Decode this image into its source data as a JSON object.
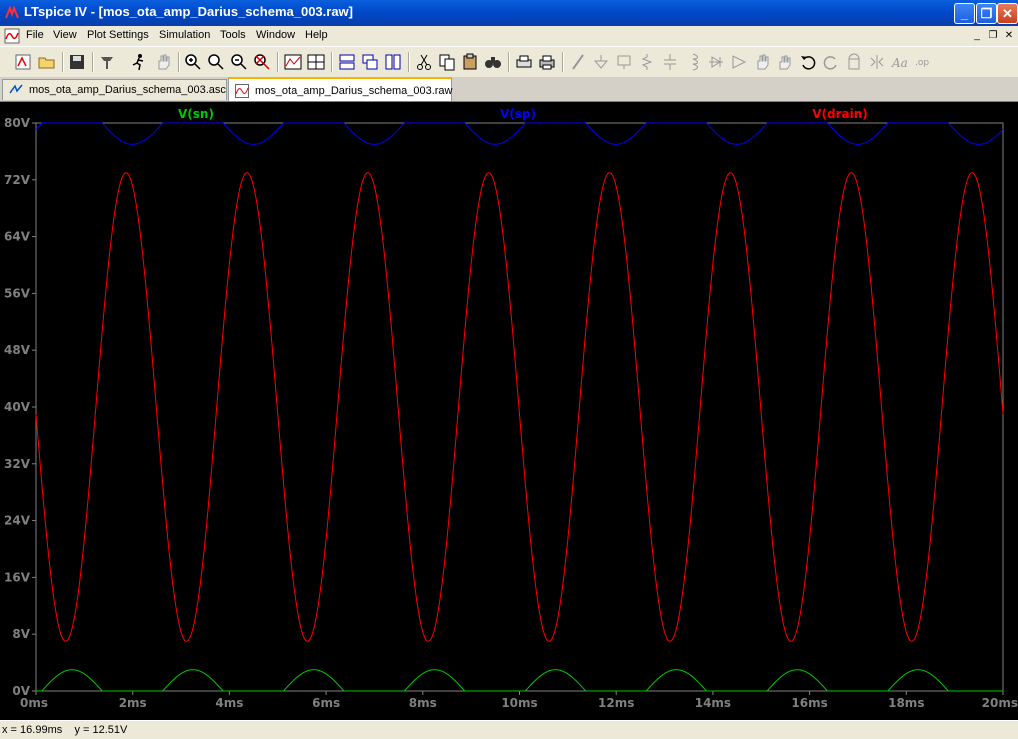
{
  "window": {
    "title": "LTspice IV - [mos_ota_amp_Darius_schema_003.raw]",
    "minimize": "_",
    "maximize": "❐",
    "close": "✕"
  },
  "menu": {
    "items": [
      "File",
      "View",
      "Plot Settings",
      "Simulation",
      "Tools",
      "Window",
      "Help"
    ],
    "mdi_restore": "_",
    "mdi_max": "❐",
    "mdi_close": "✕"
  },
  "tabs": [
    {
      "label": "mos_ota_amp_Darius_schema_003.asc",
      "icon": "schematic-icon"
    },
    {
      "label": "mos_ota_amp_Darius_schema_003.raw",
      "icon": "waveform-icon",
      "active": true
    }
  ],
  "status": {
    "text": "x = 16.99ms    y = 12.51V"
  },
  "colors": {
    "plot_bg": "#000000",
    "axis": "#808080",
    "vsn": "#00c800",
    "vsp": "#0000ff",
    "vdrain": "#ff0000"
  },
  "chart_data": {
    "type": "line",
    "xlabel": "",
    "ylabel": "",
    "xlim": [
      0,
      20
    ],
    "ylim": [
      0,
      80
    ],
    "x_unit": "ms",
    "y_unit": "V",
    "x_ticks": [
      "0ms",
      "2ms",
      "4ms",
      "6ms",
      "8ms",
      "10ms",
      "12ms",
      "14ms",
      "16ms",
      "18ms",
      "20ms"
    ],
    "y_ticks": [
      "0V",
      "8V",
      "16V",
      "24V",
      "32V",
      "40V",
      "48V",
      "56V",
      "64V",
      "72V",
      "80V"
    ],
    "grid": false,
    "frequency_hz": 400,
    "series": [
      {
        "name": "V(sn)",
        "color": "#00c800",
        "shape": "half-wave-positive",
        "baseline": 0,
        "peak": 3,
        "period_ms": 2.5
      },
      {
        "name": "V(sp)",
        "color": "#0000ff",
        "shape": "half-wave-negative",
        "baseline": 80,
        "trough": 77,
        "period_ms": 2.5
      },
      {
        "name": "V(drain)",
        "color": "#ff0000",
        "shape": "sine",
        "offset": 40,
        "amplitude": 33,
        "period_ms": 2.5,
        "start_value": 39,
        "end_value": 42
      }
    ]
  }
}
